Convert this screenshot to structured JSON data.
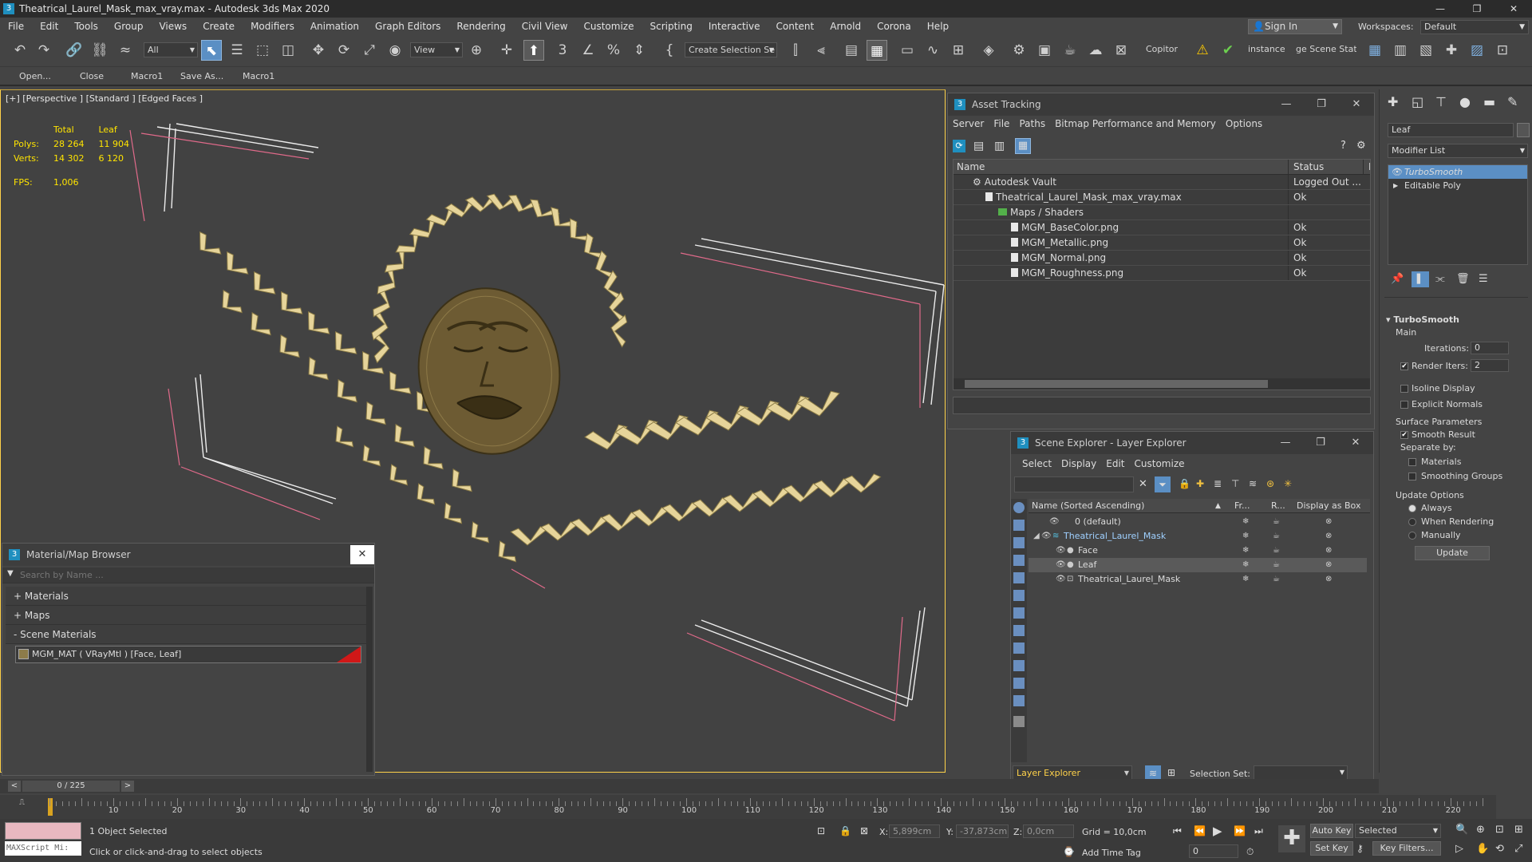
{
  "window": {
    "title": "Theatrical_Laurel_Mask_max_vray.max - Autodesk 3ds Max 2020",
    "app_icon": "3",
    "minimize": "—",
    "maximize": "❐",
    "close": "✕"
  },
  "menu": [
    "File",
    "Edit",
    "Tools",
    "Group",
    "Views",
    "Create",
    "Modifiers",
    "Animation",
    "Graph Editors",
    "Rendering",
    "Civil View",
    "Customize",
    "Scripting",
    "Interactive",
    "Content",
    "Arnold",
    "Corona",
    "Help"
  ],
  "account": {
    "sign_in": "Sign In",
    "workspaces_label": "Workspaces:",
    "workspace": "Default"
  },
  "toolbar": {
    "filter": "All",
    "view": "View",
    "selection_set": "Create Selection Se",
    "copitor": "Copitor",
    "instance": "instance",
    "scene_stat": "ge Scene Stat"
  },
  "macros": [
    "Open...",
    "Close",
    "Macro1",
    "Save As...",
    "Macro1"
  ],
  "viewport": {
    "label": "[+] [Perspective ] [Standard ] [Edged Faces ]",
    "stats": {
      "col_total": "Total",
      "col_leaf": "Leaf",
      "polys_label": "Polys:",
      "polys_total": "28 264",
      "polys_leaf": "11 904",
      "verts_label": "Verts:",
      "verts_total": "14 302",
      "verts_leaf": "6 120",
      "fps_label": "FPS:",
      "fps": "1,006"
    }
  },
  "asset_tracking": {
    "title": "Asset Tracking",
    "menu": [
      "Server",
      "File",
      "Paths",
      "Bitmap Performance and Memory",
      "Options"
    ],
    "col_name": "Name",
    "col_status": "Status",
    "col_extra": "F",
    "rows": [
      {
        "name": "Autodesk Vault",
        "status": "Logged Out ..."
      },
      {
        "name": "Theatrical_Laurel_Mask_max_vray.max",
        "status": "Ok"
      },
      {
        "name": "Maps / Shaders",
        "status": ""
      },
      {
        "name": "MGM_BaseColor.png",
        "status": "Ok"
      },
      {
        "name": "MGM_Metallic.png",
        "status": "Ok"
      },
      {
        "name": "MGM_Normal.png",
        "status": "Ok"
      },
      {
        "name": "MGM_Roughness.png",
        "status": "Ok"
      }
    ]
  },
  "scene_explorer": {
    "title": "Scene Explorer - Layer Explorer",
    "menu": [
      "Select",
      "Display",
      "Edit",
      "Customize"
    ],
    "col_name": "Name (Sorted Ascending)",
    "col_sort": "▲",
    "col_fr": "Fr...",
    "col_r": "R...",
    "col_box": "Display as Box",
    "rows": [
      {
        "name": "0 (default)"
      },
      {
        "name": "Theatrical_Laurel_Mask"
      },
      {
        "name": "Face"
      },
      {
        "name": "Leaf"
      },
      {
        "name": "Theatrical_Laurel_Mask"
      }
    ],
    "footer_explorer": "Layer Explorer",
    "selection_set_label": "Selection Set:"
  },
  "material_browser": {
    "title": "Material/Map Browser",
    "search_placeholder": "Search by Name ...",
    "materials": "+ Materials",
    "maps": "+ Maps",
    "scene_materials": "- Scene Materials",
    "scene_material_item": "MGM_MAT ( VRayMtl ) [Face, Leaf]"
  },
  "command_panel": {
    "object_name": "Leaf",
    "modifier_list": "Modifier List",
    "stack": [
      "TurboSmooth",
      "Editable Poly"
    ],
    "rollout_title": "TurboSmooth",
    "main": "Main",
    "iterations_label": "Iterations:",
    "iterations": "0",
    "render_iters_label": "Render Iters:",
    "render_iters": "2",
    "isoline": "Isoline Display",
    "explicit_normals": "Explicit Normals",
    "surface_params": "Surface Parameters",
    "smooth_result": "Smooth Result",
    "separate_by": "Separate by:",
    "materials": "Materials",
    "smoothing_groups": "Smoothing Groups",
    "update_options": "Update Options",
    "always": "Always",
    "when_rendering": "When Rendering",
    "manually": "Manually",
    "update_button": "Update"
  },
  "timeline": {
    "frame_counter": "0 / 225",
    "prev": "<",
    "next": ">",
    "ticks": [
      "10",
      "20",
      "30",
      "40",
      "50",
      "60",
      "70",
      "80",
      "90",
      "100",
      "110",
      "120",
      "130",
      "140",
      "150",
      "160",
      "170",
      "180",
      "190",
      "200",
      "210",
      "220"
    ]
  },
  "status": {
    "maxscript": "MAXScript Mi:",
    "selected": "1 Object Selected",
    "prompt": "Click or click-and-drag to select objects",
    "x_label": "X:",
    "x": "5,899cm",
    "y_label": "Y:",
    "y": "-37,873cm",
    "z_label": "Z:",
    "z": "0,0cm",
    "grid": "Grid = 10,0cm",
    "add_time_tag": "Add Time Tag",
    "auto_key": "Auto Key",
    "set_key": "Set Key",
    "key_mode": "Selected",
    "key_filters": "Key Filters...",
    "frame": "0"
  },
  "colors": {
    "accent": "#5b8fc4",
    "viewport_border": "#ffd24a",
    "stats": "#ffe400",
    "wire": "#e0c877"
  }
}
